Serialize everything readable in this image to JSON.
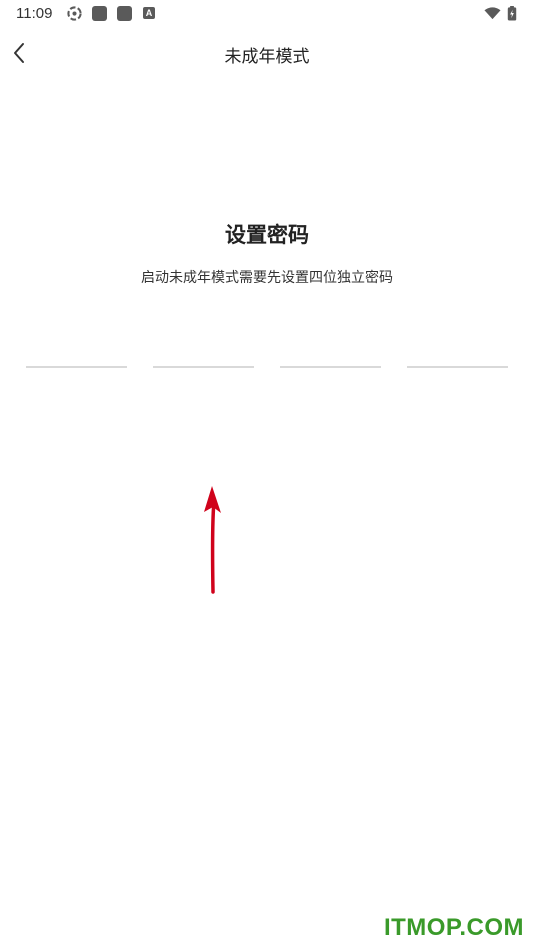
{
  "status_bar": {
    "time": "11:09",
    "notification_letter": "A",
    "icons": [
      "sync-icon",
      "app-icon",
      "app-icon",
      "font-app-icon",
      "wifi-icon",
      "battery-icon"
    ]
  },
  "nav": {
    "title": "未成年模式",
    "back_icon": "chevron-left-icon"
  },
  "main": {
    "heading": "设置密码",
    "subtitle": "启动未成年模式需要先设置四位独立密码",
    "pin_inputs": [
      "",
      "",
      "",
      ""
    ]
  },
  "annotation": {
    "color": "#d0021b"
  },
  "watermark": {
    "text": "ITMOP.COM",
    "color": "#3a9a2a"
  }
}
